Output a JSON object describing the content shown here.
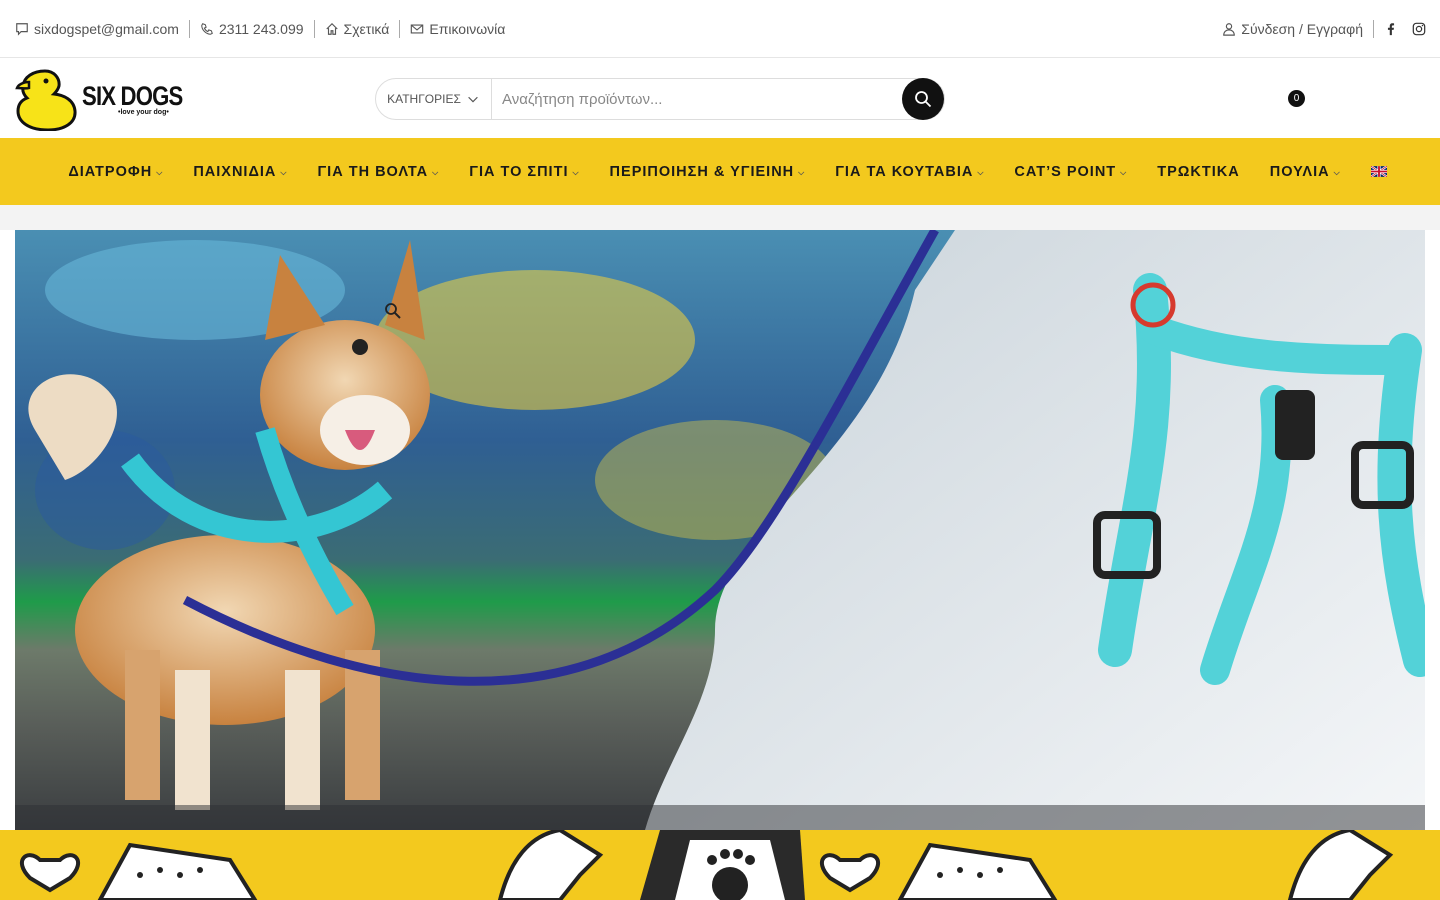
{
  "topbar": {
    "email": "sixdogspet@gmail.com",
    "phone": "2311 243.099",
    "about": "Σχετικά",
    "contact": "Επικοινωνία",
    "login": "Σύνδεση / Εγγραφή"
  },
  "logo": {
    "name": "SIX DOGS",
    "tagline": "•love your dog•"
  },
  "search": {
    "category_label": "ΚΑΤΗΓΟΡΙΕΣ",
    "placeholder": "Αναζήτηση προϊόντων..."
  },
  "cart": {
    "count": "0"
  },
  "nav": {
    "items": [
      {
        "label": "ΔΙΑΤΡΟΦΗ",
        "dropdown": true
      },
      {
        "label": "ΠΑΙΧΝΙΔΙΑ",
        "dropdown": true
      },
      {
        "label": "ΓΙΑ ΤΗ ΒΟΛΤΑ",
        "dropdown": true
      },
      {
        "label": "ΓΙΑ ΤΟ ΣΠΙΤΙ",
        "dropdown": true
      },
      {
        "label": "ΠΕΡΙΠΟΙΗΣΗ & ΥΓΙΕΙΝΗ",
        "dropdown": true
      },
      {
        "label": "ΓΙΑ ΤΑ ΚΟΥΤΑΒΙΑ",
        "dropdown": true
      },
      {
        "label": "CAT’S POINT",
        "dropdown": true
      },
      {
        "label": "ΤΡΩΚΤΙΚΑ",
        "dropdown": false
      },
      {
        "label": "ΠΟΥΛΙΑ",
        "dropdown": true
      }
    ],
    "caret": "⌵"
  },
  "colors": {
    "brand_yellow": "#f3c91e",
    "dark": "#111111"
  },
  "icons": {
    "email": "chat-icon",
    "phone": "phone-icon",
    "about": "home-icon",
    "contact": "envelope-icon",
    "login": "user-icon",
    "facebook": "facebook-icon",
    "instagram": "instagram-icon",
    "search": "search-icon",
    "language": "uk-flag-icon"
  }
}
